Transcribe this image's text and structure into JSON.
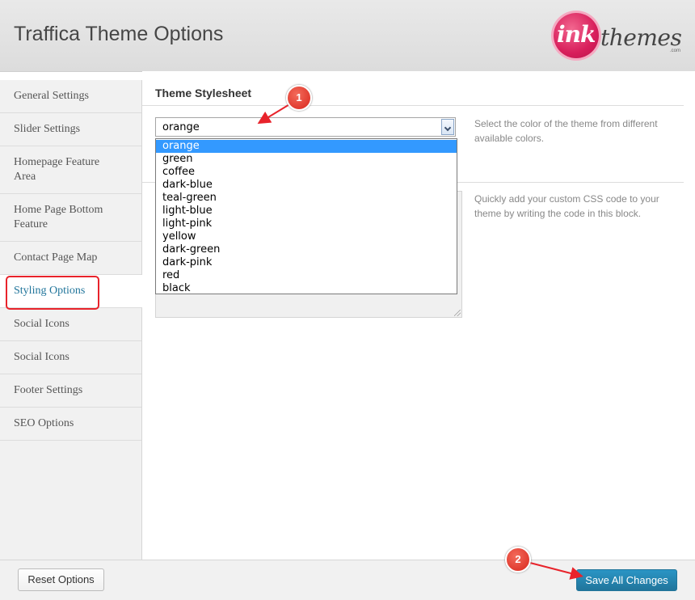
{
  "header": {
    "title": "Traffica Theme Options",
    "logo": {
      "ink": "ink",
      "themes": "themes",
      "com": ".com"
    }
  },
  "sidebar": {
    "items": [
      {
        "label": "General Settings"
      },
      {
        "label": "Slider Settings"
      },
      {
        "label": "Homepage Feature Area"
      },
      {
        "label": "Home Page Bottom Feature"
      },
      {
        "label": "Contact Page Map"
      },
      {
        "label": "Styling Options",
        "active": true
      },
      {
        "label": "Social Icons"
      },
      {
        "label": "Social Icons"
      },
      {
        "label": "Footer Settings"
      },
      {
        "label": "SEO Options"
      }
    ]
  },
  "main": {
    "section_title": "Theme Stylesheet",
    "stylesheet_select": {
      "value": "orange",
      "options": [
        "orange",
        "green",
        "coffee",
        "dark-blue",
        "teal-green",
        "light-blue",
        "light-pink",
        "yellow",
        "dark-green",
        "dark-pink",
        "red",
        "black"
      ],
      "highlighted": "orange",
      "help": "Select the color of the theme from different available colors."
    },
    "custom_css": {
      "value": "",
      "help": "Quickly add your custom CSS code to your theme by writing the code in this block."
    }
  },
  "footer": {
    "reset_label": "Reset Options",
    "save_label": "Save All Changes"
  },
  "annotations": {
    "badge1": "1",
    "badge2": "2",
    "accent_color": "#e8232b"
  }
}
